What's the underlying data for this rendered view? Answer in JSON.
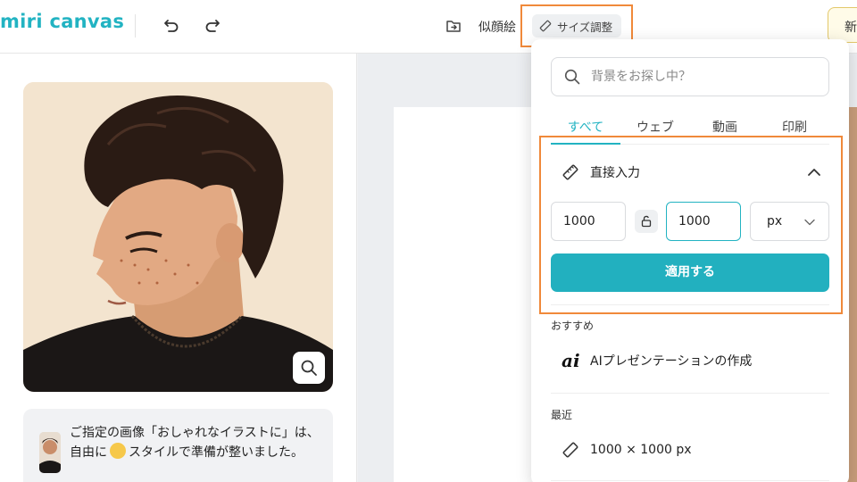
{
  "app": {
    "logo_text": "miri canvas"
  },
  "toolbar": {
    "similar_label": "似顔絵",
    "resize_label": "サイズ調整",
    "new_label": "新"
  },
  "left": {
    "message": "ご指定の画像「おしゃれなイラストに」は、 自由に 😎 スタイルで準備が整いました。",
    "message_part1": "ご指定の画像「おしゃれなイラストに」は、 自由に",
    "message_part2": "スタイルで準備が整いました。"
  },
  "dropdown": {
    "search_placeholder": "背景をお探し中？",
    "tabs": [
      {
        "label": "すべて",
        "active": true
      },
      {
        "label": "ウェブ",
        "active": false
      },
      {
        "label": "動画",
        "active": false
      },
      {
        "label": "印刷",
        "active": false
      }
    ],
    "direct_input_label": "直接入力",
    "width_value": "1000",
    "height_value": "1000",
    "unit": "px",
    "apply_label": "適用する",
    "recommended_label": "おすすめ",
    "recommended_item": "AIプレゼンテーションの作成",
    "recent_label": "最近",
    "recent_item": "1000 × 1000 px"
  },
  "colors": {
    "accent": "#22b3c2",
    "highlight": "#f0893a",
    "apply_button": "#22b0bf"
  },
  "icons": {
    "undo": "undo-icon",
    "redo": "redo-icon",
    "export": "export-icon",
    "ruler": "ruler-icon",
    "search": "search-icon",
    "lock": "unlock-icon",
    "chevron_up": "chevron-up-icon",
    "chevron_down": "chevron-down-icon",
    "zoom": "zoom-icon"
  }
}
